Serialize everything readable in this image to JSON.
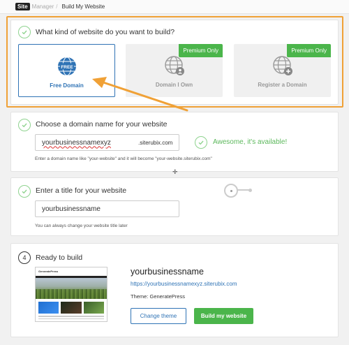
{
  "breadcrumb": {
    "logo": "Site",
    "manager": "Manager",
    "separator": "/",
    "current": "Build My Website"
  },
  "step1": {
    "title": "What kind of website do you want to build?",
    "options": [
      {
        "label": "Free Domain",
        "selected": true,
        "badge": "",
        "icon": "globe-free-icon"
      },
      {
        "label": "Domain I Own",
        "selected": false,
        "badge": "Premium Only",
        "icon": "globe-user-icon"
      },
      {
        "label": "Register a Domain",
        "selected": false,
        "badge": "Premium Only",
        "icon": "globe-plus-icon"
      }
    ],
    "free_text": "FREE"
  },
  "step2": {
    "title": "Choose a domain name for your website",
    "domain_value": "yourbusinessnamexyz",
    "suffix": ".siterubix.com",
    "availability": "Awesome, it's available!",
    "hint": "Enter a domain name like \"your-website\" and it will become \"your-website.siterubix.com\""
  },
  "step3": {
    "title": "Enter a title for your website",
    "title_value": "yourbusinessname",
    "hint": "You can always change your website title later"
  },
  "step4": {
    "number": "4",
    "title": "Ready to build",
    "thumb_brand": "GeneratePress",
    "site_name": "yourbusinessname",
    "site_url": "https://yourbusinessnamexyz.siterubix.com",
    "theme": "Theme: GeneratePress",
    "change_theme": "Change theme",
    "build": "Build my website"
  },
  "cursor": "✛",
  "colors": {
    "accent_blue": "#2f73b5",
    "green": "#4bb54b",
    "highlight_orange": "#f0a136",
    "check_green": "#8fd38f"
  }
}
